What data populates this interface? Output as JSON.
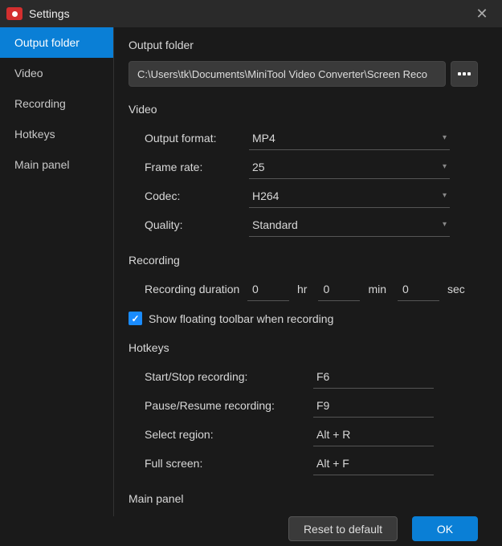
{
  "window": {
    "title": "Settings"
  },
  "sidebar": {
    "items": [
      {
        "label": "Output folder",
        "active": true
      },
      {
        "label": "Video"
      },
      {
        "label": "Recording"
      },
      {
        "label": "Hotkeys"
      },
      {
        "label": "Main panel"
      }
    ]
  },
  "output": {
    "title": "Output folder",
    "path": "C:\\Users\\tk\\Documents\\MiniTool Video Converter\\Screen Reco"
  },
  "video": {
    "title": "Video",
    "format_label": "Output format:",
    "format_value": "MP4",
    "framerate_label": "Frame rate:",
    "framerate_value": "25",
    "codec_label": "Codec:",
    "codec_value": "H264",
    "quality_label": "Quality:",
    "quality_value": "Standard"
  },
  "recording": {
    "title": "Recording",
    "duration_label": "Recording duration",
    "hr_value": "0",
    "hr_unit": "hr",
    "min_value": "0",
    "min_unit": "min",
    "sec_value": "0",
    "sec_unit": "sec",
    "checkbox_label": "Show floating toolbar when recording",
    "checkbox_checked": true
  },
  "hotkeys": {
    "title": "Hotkeys",
    "rows": [
      {
        "label": "Start/Stop recording:",
        "value": "F6"
      },
      {
        "label": "Pause/Resume recording:",
        "value": "F9"
      },
      {
        "label": "Select region:",
        "value": "Alt + R"
      },
      {
        "label": "Full screen:",
        "value": "Alt + F"
      }
    ]
  },
  "mainpanel": {
    "title": "Main panel"
  },
  "footer": {
    "reset": "Reset to default",
    "ok": "OK"
  }
}
